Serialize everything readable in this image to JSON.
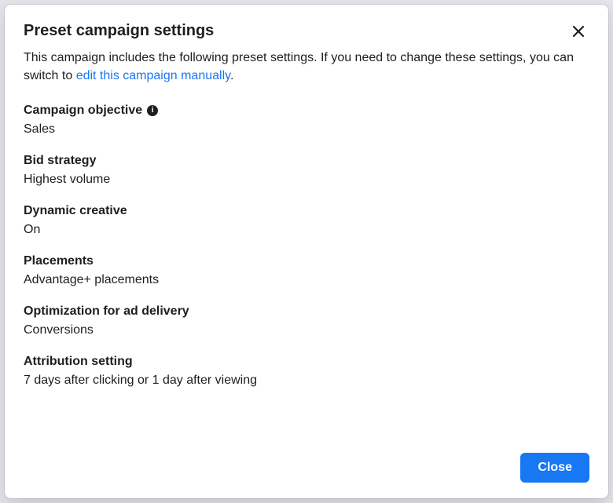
{
  "title": "Preset campaign settings",
  "description_pre": "This campaign includes the following preset settings. If you need to change these settings, you can switch to ",
  "description_link": "edit this campaign manually",
  "description_post": ".",
  "sections": {
    "campaign_objective": {
      "label": "Campaign objective",
      "value": "Sales"
    },
    "bid_strategy": {
      "label": "Bid strategy",
      "value": "Highest volume"
    },
    "dynamic_creative": {
      "label": "Dynamic creative",
      "value": "On"
    },
    "placements": {
      "label": "Placements",
      "value": "Advantage+ placements"
    },
    "optimization": {
      "label": "Optimization for ad delivery",
      "value": "Conversions"
    },
    "attribution": {
      "label": "Attribution setting",
      "value": "7 days after clicking or 1 day after viewing"
    }
  },
  "buttons": {
    "close": "Close"
  },
  "info_glyph": "i"
}
